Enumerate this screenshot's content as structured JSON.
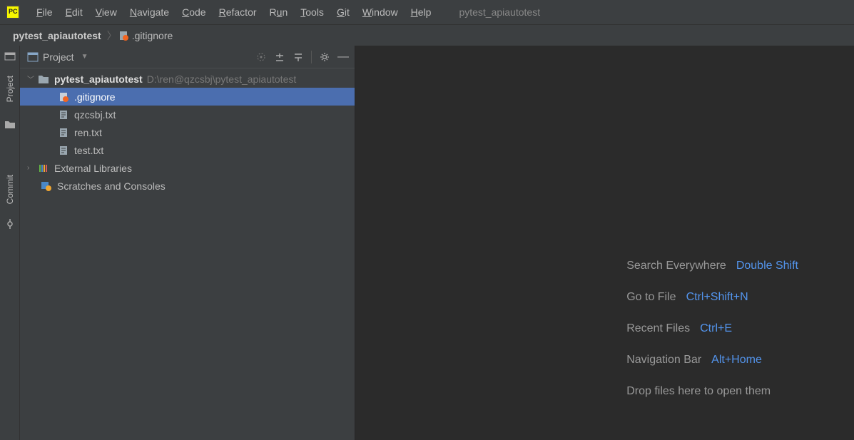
{
  "menubar": {
    "items": [
      {
        "label": "File",
        "u": "F"
      },
      {
        "label": "Edit",
        "u": "E"
      },
      {
        "label": "View",
        "u": "V"
      },
      {
        "label": "Navigate",
        "u": "N"
      },
      {
        "label": "Code",
        "u": "C"
      },
      {
        "label": "Refactor",
        "u": "R"
      },
      {
        "label": "Run",
        "u": "u",
        "pre": "R"
      },
      {
        "label": "Tools",
        "u": "T"
      },
      {
        "label": "Git",
        "u": "G"
      },
      {
        "label": "Window",
        "u": "W"
      },
      {
        "label": "Help",
        "u": "H"
      }
    ],
    "title": "pytest_apiautotest"
  },
  "navbar": {
    "crumb1": "pytest_apiautotest",
    "crumb2": ".gitignore"
  },
  "gutter": {
    "project": "Project",
    "commit": "Commit"
  },
  "panel": {
    "title": "Project"
  },
  "tree": {
    "root_name": "pytest_apiautotest",
    "root_hint": "D:\\ren@qzcsbj\\pytest_apiautotest",
    "files": [
      {
        "name": ".gitignore",
        "selected": true,
        "icon": "git"
      },
      {
        "name": "qzcsbj.txt",
        "selected": false,
        "icon": "txt"
      },
      {
        "name": "ren.txt",
        "selected": false,
        "icon": "txt"
      },
      {
        "name": "test.txt",
        "selected": false,
        "icon": "txt"
      }
    ],
    "external": "External Libraries",
    "scratches": "Scratches and Consoles"
  },
  "welcome": {
    "rows": [
      {
        "label": "Search Everywhere",
        "key": "Double Shift"
      },
      {
        "label": "Go to File",
        "key": "Ctrl+Shift+N"
      },
      {
        "label": "Recent Files",
        "key": "Ctrl+E"
      },
      {
        "label": "Navigation Bar",
        "key": "Alt+Home"
      },
      {
        "label": "Drop files here to open them",
        "key": ""
      }
    ]
  }
}
